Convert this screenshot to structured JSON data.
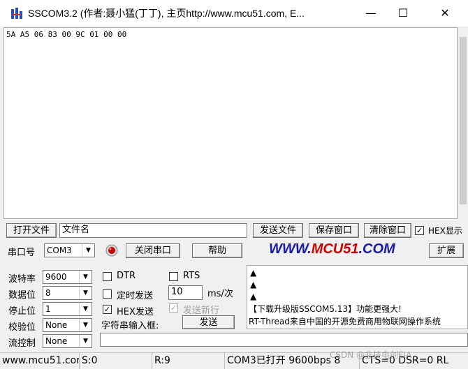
{
  "window": {
    "title": "SSCOM3.2 (作者:聂小猛(丁丁), 主页http://www.mcu51.com, E...",
    "minimize": "—",
    "maximize": "☐",
    "close": "✕"
  },
  "receive": {
    "text": "5A A5 06 83 00 9C 01 00 00"
  },
  "file_row": {
    "open_file": "打开文件",
    "file_name": "文件名",
    "send_file": "发送文件",
    "save_window": "保存窗口",
    "clear_window": "清除窗口",
    "hex_display_checked": true,
    "hex_display": "HEX显示"
  },
  "port_row": {
    "port_label": "串口号",
    "port_value": "COM3",
    "close_port": "关闭串口",
    "help": "帮助",
    "brand": "WWW.MCU51.COM",
    "expand": "扩展"
  },
  "settings": {
    "baud_label": "波特率",
    "baud_value": "9600",
    "databits_label": "数据位",
    "databits_value": "8",
    "stopbits_label": "停止位",
    "stopbits_value": "1",
    "parity_label": "校验位",
    "parity_value": "None",
    "flow_label": "流控制",
    "flow_value": "None"
  },
  "send_opts": {
    "dtr": "DTR",
    "rts": "RTS",
    "timed_send": "定时发送",
    "interval_value": "10",
    "interval_unit": "ms/次",
    "hex_send_checked": true,
    "hex_send": "HEX发送",
    "newline_checked": true,
    "newline": "发送新行",
    "input_label": "字符串输入框:",
    "send": "发送",
    "input_value": ""
  },
  "hint": {
    "tri": "▲",
    "line1": "【下载升级版SSCOM5.13】功能更强大!",
    "line2": "RT-Thread来自中国的开源免费商用物联网操作系统"
  },
  "status": {
    "site": "www.mcu51.cor",
    "sent": "S:0",
    "received": "R:9",
    "port_state": "COM3已打开  9600bps  8",
    "lines": "CTS=0 DSR=0 RL",
    "watermark": "CSDN @韭技电创EIA"
  },
  "colors": {
    "brand_blue": "#1a1aa8",
    "brand_red": "#d40000",
    "led_red": "#c00000"
  }
}
